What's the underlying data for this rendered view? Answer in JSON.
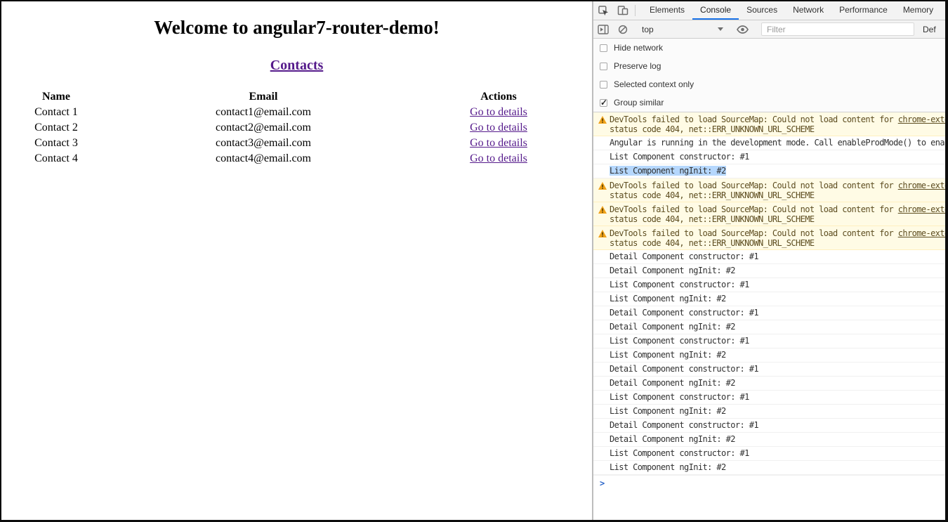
{
  "page": {
    "title": "Welcome to angular7-router-demo!",
    "nav_link": "Contacts",
    "link_color": "#551A8B",
    "table": {
      "headers": [
        "Name",
        "Email",
        "Actions"
      ],
      "rows": [
        {
          "name": "Contact 1",
          "email": "contact1@email.com",
          "action": "Go to details"
        },
        {
          "name": "Contact 2",
          "email": "contact2@email.com",
          "action": "Go to details"
        },
        {
          "name": "Contact 3",
          "email": "contact3@email.com",
          "action": "Go to details"
        },
        {
          "name": "Contact 4",
          "email": "contact4@email.com",
          "action": "Go to details"
        }
      ]
    }
  },
  "devtools": {
    "tabs": [
      {
        "label": "Elements",
        "active": false
      },
      {
        "label": "Console",
        "active": true
      },
      {
        "label": "Sources",
        "active": false
      },
      {
        "label": "Network",
        "active": false
      },
      {
        "label": "Performance",
        "active": false
      },
      {
        "label": "Memory",
        "active": false
      }
    ],
    "toolbar": {
      "icons": [
        "inspect-icon",
        "device-toolbar-icon",
        "console-sidebar-icon",
        "clear-console-icon",
        "eye-icon"
      ],
      "context_selector": "top",
      "filter_placeholder": "Filter",
      "levels_label_partial": "Def"
    },
    "settings": [
      {
        "label": "Hide network",
        "checked": false
      },
      {
        "label": "Preserve log",
        "checked": false
      },
      {
        "label": "Selected context only",
        "checked": false
      },
      {
        "label": "Group similar",
        "checked": true
      }
    ],
    "console": {
      "warning": {
        "line1": "DevTools failed to load SourceMap: Could not load content for ",
        "link": "chrome-exte",
        "line2": "status code 404, net::ERR_UNKNOWN_URL_SCHEME"
      },
      "messages": [
        {
          "type": "warn"
        },
        {
          "type": "log",
          "text": "Angular is running in the development mode. Call enableProdMode() to enab"
        },
        {
          "type": "log",
          "text": "List Component constructor: #1"
        },
        {
          "type": "log",
          "text": "List Component ngInit: #2",
          "selected": true
        },
        {
          "type": "warn"
        },
        {
          "type": "warn"
        },
        {
          "type": "warn"
        },
        {
          "type": "log",
          "text": "Detail Component constructor: #1"
        },
        {
          "type": "log",
          "text": "Detail Component ngInit: #2"
        },
        {
          "type": "log",
          "text": "List Component constructor: #1"
        },
        {
          "type": "log",
          "text": "List Component ngInit: #2"
        },
        {
          "type": "log",
          "text": "Detail Component constructor: #1"
        },
        {
          "type": "log",
          "text": "Detail Component ngInit: #2"
        },
        {
          "type": "log",
          "text": "List Component constructor: #1"
        },
        {
          "type": "log",
          "text": "List Component ngInit: #2"
        },
        {
          "type": "log",
          "text": "Detail Component constructor: #1"
        },
        {
          "type": "log",
          "text": "Detail Component ngInit: #2"
        },
        {
          "type": "log",
          "text": "List Component constructor: #1"
        },
        {
          "type": "log",
          "text": "List Component ngInit: #2"
        },
        {
          "type": "log",
          "text": "Detail Component constructor: #1"
        },
        {
          "type": "log",
          "text": "Detail Component ngInit: #2"
        },
        {
          "type": "log",
          "text": "List Component constructor: #1"
        },
        {
          "type": "log",
          "text": "List Component ngInit: #2"
        }
      ],
      "prompt": ">"
    },
    "colors": {
      "accent_blue": "#1a73e8",
      "toolbar_bg": "#f3f3f3",
      "warning_bg": "#fffbe5",
      "warning_text": "#5d4d20",
      "warning_icon": "#f0a21a",
      "selection_bg": "#b5d7fd",
      "prompt_blue": "#2b66c9"
    }
  }
}
